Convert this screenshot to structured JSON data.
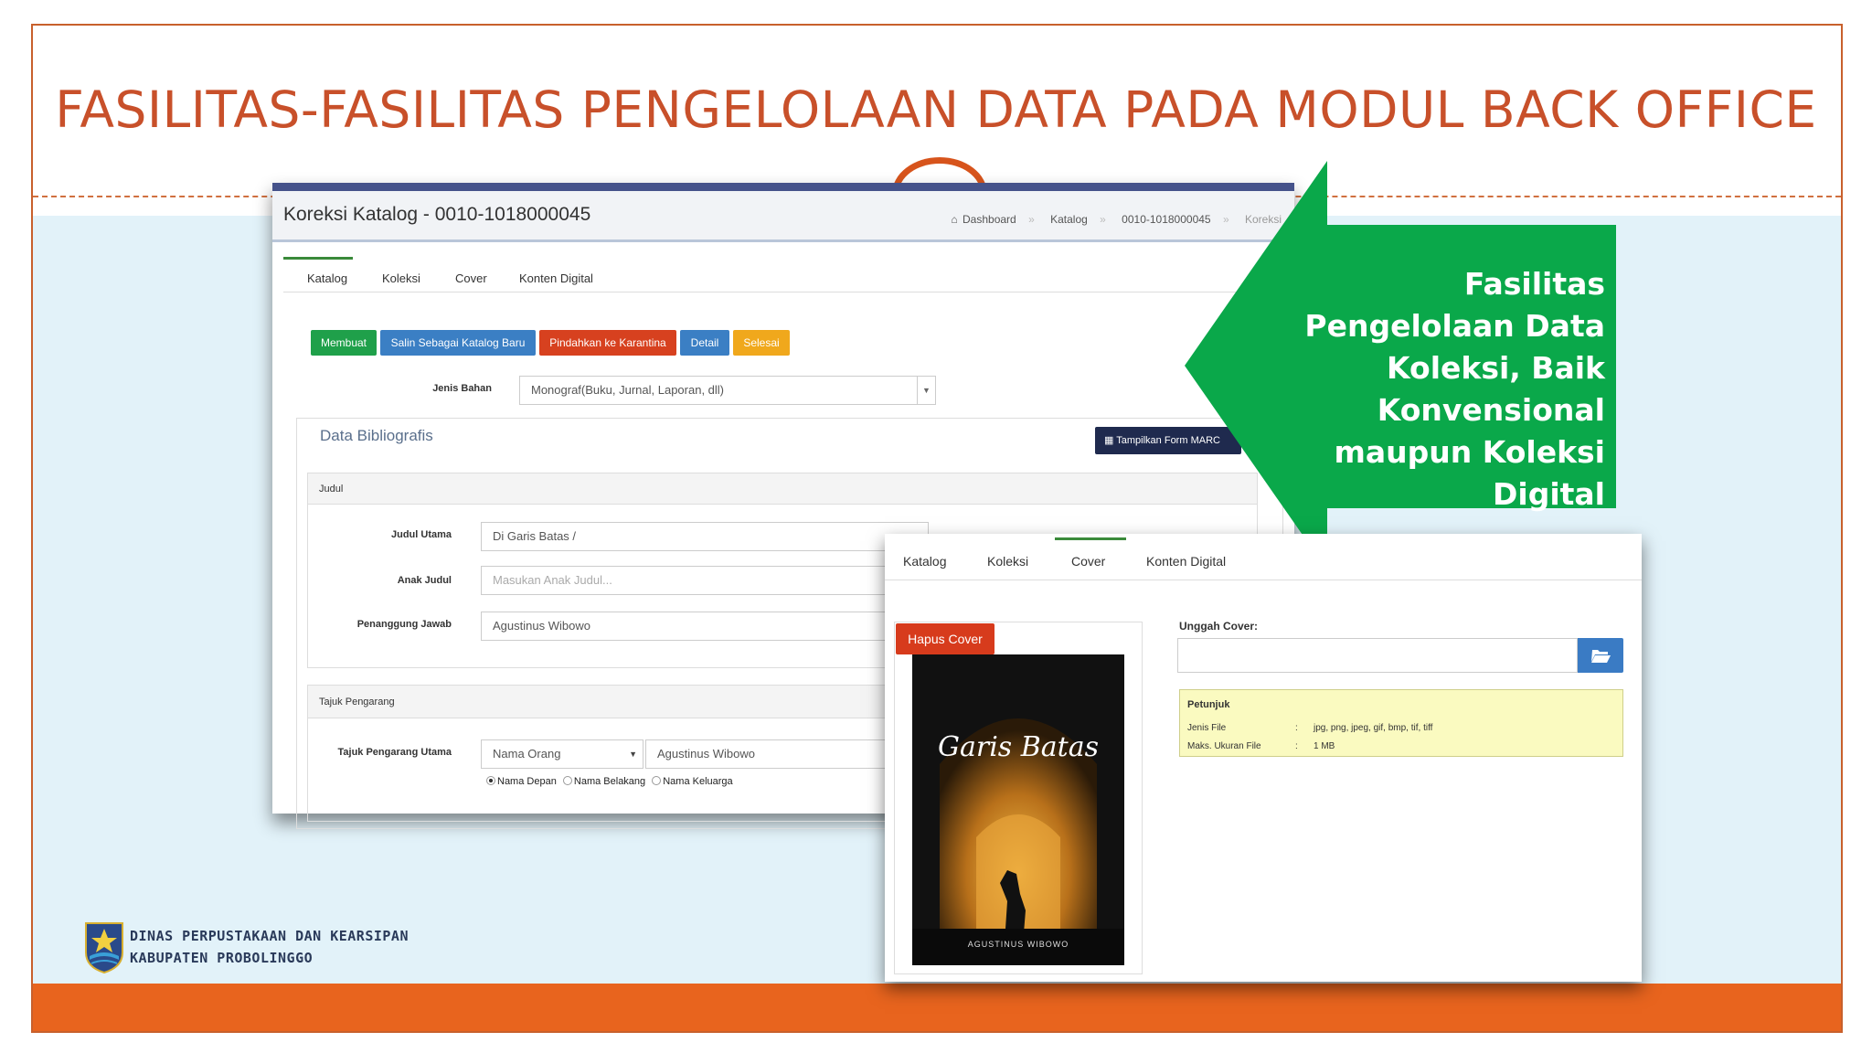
{
  "slide": {
    "title": "FASILITAS-FASILITAS PENGELOLAAN DATA PADA MODUL BACK OFFICE",
    "callout_lines": [
      "Fasilitas",
      "Pengelolaan Data",
      "Koleksi, Baik",
      "Konvensional",
      "maupun Koleksi",
      "Digital"
    ],
    "logo_lines": [
      "DINAS PERPUSTAKAAN DAN KEARSIPAN",
      "KABUPATEN PROBOLINGGO"
    ],
    "colors": {
      "title": "#c8502a",
      "accent": "#e8641e",
      "callout": "#0aa84a",
      "band": "#e2f2f9"
    }
  },
  "catalog_window": {
    "title": "Koreksi Katalog - 0010-1018000045",
    "breadcrumb": [
      "Dashboard",
      "Katalog",
      "0010-1018000045",
      "Koreksi"
    ],
    "breadcrumb_icon": "home-icon",
    "tabs": [
      "Katalog",
      "Koleksi",
      "Cover",
      "Konten Digital"
    ],
    "active_tab": "Katalog",
    "buttons": [
      {
        "label": "Membuat",
        "color": "#1fa04a"
      },
      {
        "label": "Salin Sebagai Katalog Baru",
        "color": "#3b7fc4"
      },
      {
        "label": "Pindahkan ke Karantina",
        "color": "#d7411f"
      },
      {
        "label": "Detail",
        "color": "#3b7fc4"
      },
      {
        "label": "Selesai",
        "color": "#f0a81c"
      }
    ],
    "jenis_bahan_label": "Jenis Bahan",
    "jenis_bahan_value": "Monograf(Buku, Jurnal, Laporan, dll)",
    "section_title": "Data Bibliografis",
    "marc_button": "Tampilkan Form MARC",
    "judul_panel": "Judul",
    "judul_utama_label": "Judul Utama",
    "judul_utama_value": "Di Garis Batas /",
    "anak_judul_label": "Anak Judul",
    "anak_judul_placeholder": "Masukan Anak Judul...",
    "penanggung_label": "Penanggung Jawab",
    "penanggung_value": "Agustinus Wibowo",
    "pengarang_panel": "Tajuk Pengarang",
    "pengarang_label": "Tajuk Pengarang Utama",
    "pengarang_type": "Nama Orang",
    "pengarang_value": "Agustinus Wibowo",
    "radio_options": [
      "Nama Depan",
      "Nama Belakang",
      "Nama Keluarga"
    ],
    "radio_selected": "Nama Depan"
  },
  "cover_window": {
    "tabs": [
      "Katalog",
      "Koleksi",
      "Cover",
      "Konten Digital"
    ],
    "active_tab": "Cover",
    "hapus_button": "Hapus Cover",
    "unggah_label": "Unggah Cover:",
    "browse_icon": "folder-open-icon",
    "petunjuk_title": "Petunjuk",
    "petunjuk_rows": [
      {
        "key": "Jenis File",
        "sep": ":",
        "value": "jpg, png, jpeg, gif, bmp, tif, tiff"
      },
      {
        "key": "Maks. Ukuran File",
        "sep": ":",
        "value": "1 MB"
      }
    ],
    "book": {
      "title": "Garis Batas",
      "author": "AGUSTINUS WIBOWO"
    }
  }
}
